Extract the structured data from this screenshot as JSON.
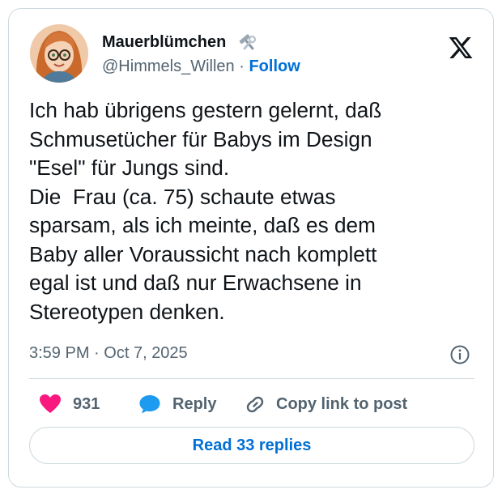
{
  "author": {
    "display_name": "Mauerblümchen",
    "handle": "@Himmels_Willen",
    "separator": "·",
    "follow_label": "Follow",
    "name_emoji_icon": "hammer-and-wrench-icon"
  },
  "tweet": {
    "text": "Ich hab übrigens gestern gelernt, daß\nSchmusetücher für Babys im Design\n\"Esel\" für Jungs sind.\nDie  Frau (ca. 75) schaute etwas\nsparsam, als ich meinte, daß es dem\nBaby aller Voraussicht nach komplett\negal ist und daß nur Erwachsene in\nStereotypen denken.",
    "time": "3:59 PM",
    "date_separator": "·",
    "date": "Oct 7, 2025"
  },
  "actions": {
    "like_count": "931",
    "reply_label": "Reply",
    "copy_label": "Copy link to post"
  },
  "footer": {
    "read_replies_label": "Read 33 replies"
  },
  "colors": {
    "accent": "#006fd6",
    "like": "#f91880",
    "reply": "#1d9bf0",
    "muted": "#536471",
    "border": "#cfd9de",
    "text": "#0f1419"
  }
}
